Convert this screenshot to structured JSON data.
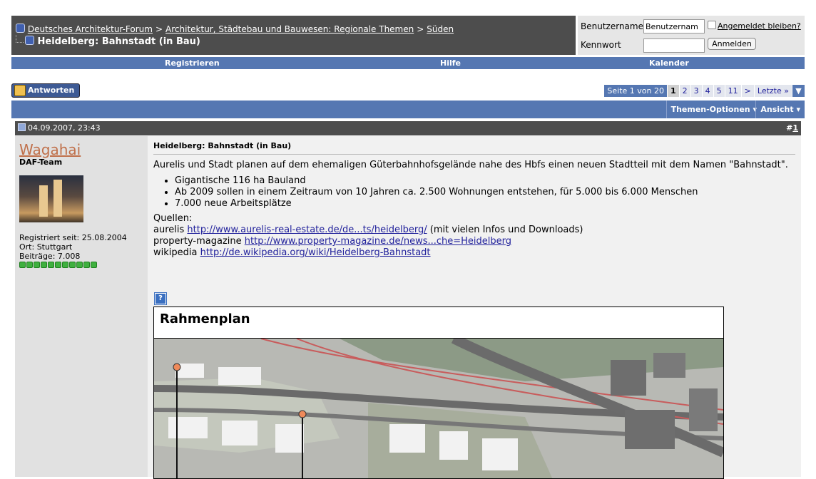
{
  "breadcrumb": {
    "items": [
      "Deutsches Architektur-Forum",
      "Architektur, Städtebau und Bauwesen: Regionale Themen",
      "Süden"
    ],
    "separator": ">"
  },
  "thread_title": "Heidelberg: Bahnstadt (in Bau)",
  "login": {
    "username_label": "Benutzername",
    "username_value": "Benutzernam",
    "password_label": "Kennwort",
    "remember_label": "Angemeldet bleiben?",
    "submit_label": "Anmelden"
  },
  "nav": {
    "register": "Registrieren",
    "help": "Hilfe",
    "calendar": "Kalender"
  },
  "reply_label": "Antworten",
  "pager": {
    "label": "Seite 1 von 20",
    "pages": [
      "1",
      "2",
      "3",
      "4",
      "5",
      "11",
      ">",
      "Letzte »"
    ],
    "current": "1",
    "dropdown": "▼"
  },
  "options": {
    "thread_options": "Themen-Optionen",
    "view": "Ansicht"
  },
  "post": {
    "date": "04.09.2007, 23:43",
    "number_prefix": "#",
    "number": "1",
    "author": {
      "name": "Wagahai",
      "title": "DAF-Team",
      "registered": "Registriert seit: 25.08.2004",
      "location": "Ort: Stuttgart",
      "posts": "Beiträge: 7.008",
      "reputation_pips": 11
    },
    "title": "Heidelberg: Bahnstadt (in Bau)",
    "intro": "Aurelis und Stadt planen auf dem ehemaligen Güterbahnhofsgelände nahe des Hbfs einen neuen Stadtteil mit dem Namen \"Bahnstadt\".",
    "bullets": [
      "Gigantische 116 ha Bauland",
      "Ab 2009 sollen in einem Zeitraum von 10 Jahren ca. 2.500 Wohnungen entstehen, für 5.000 bis 6.000 Menschen",
      "7.000 neue Arbeitsplätze"
    ],
    "sources_label": "Quellen:",
    "sources": [
      {
        "name": "aurelis",
        "link": "http://www.aurelis-real-estate.de/de...ts/heidelberg/",
        "note": "(mit vielen Infos und Downloads)"
      },
      {
        "name": "property-magazine",
        "link": "http://www.property-magazine.de/news...che=Heidelberg",
        "note": ""
      },
      {
        "name": "wikipedia",
        "link": "http://de.wikipedia.org/wiki/Heidelberg-Bahnstadt",
        "note": ""
      }
    ],
    "image_button": "?",
    "image_title": "Rahmenplan"
  },
  "colors": {
    "header_dark": "#4d4d4d",
    "nav_blue": "#5577b2",
    "user_col": "#e1e1e1",
    "post_bg": "#f1f1f1",
    "username": "#c0704a",
    "reputation": "#3fb03f"
  }
}
